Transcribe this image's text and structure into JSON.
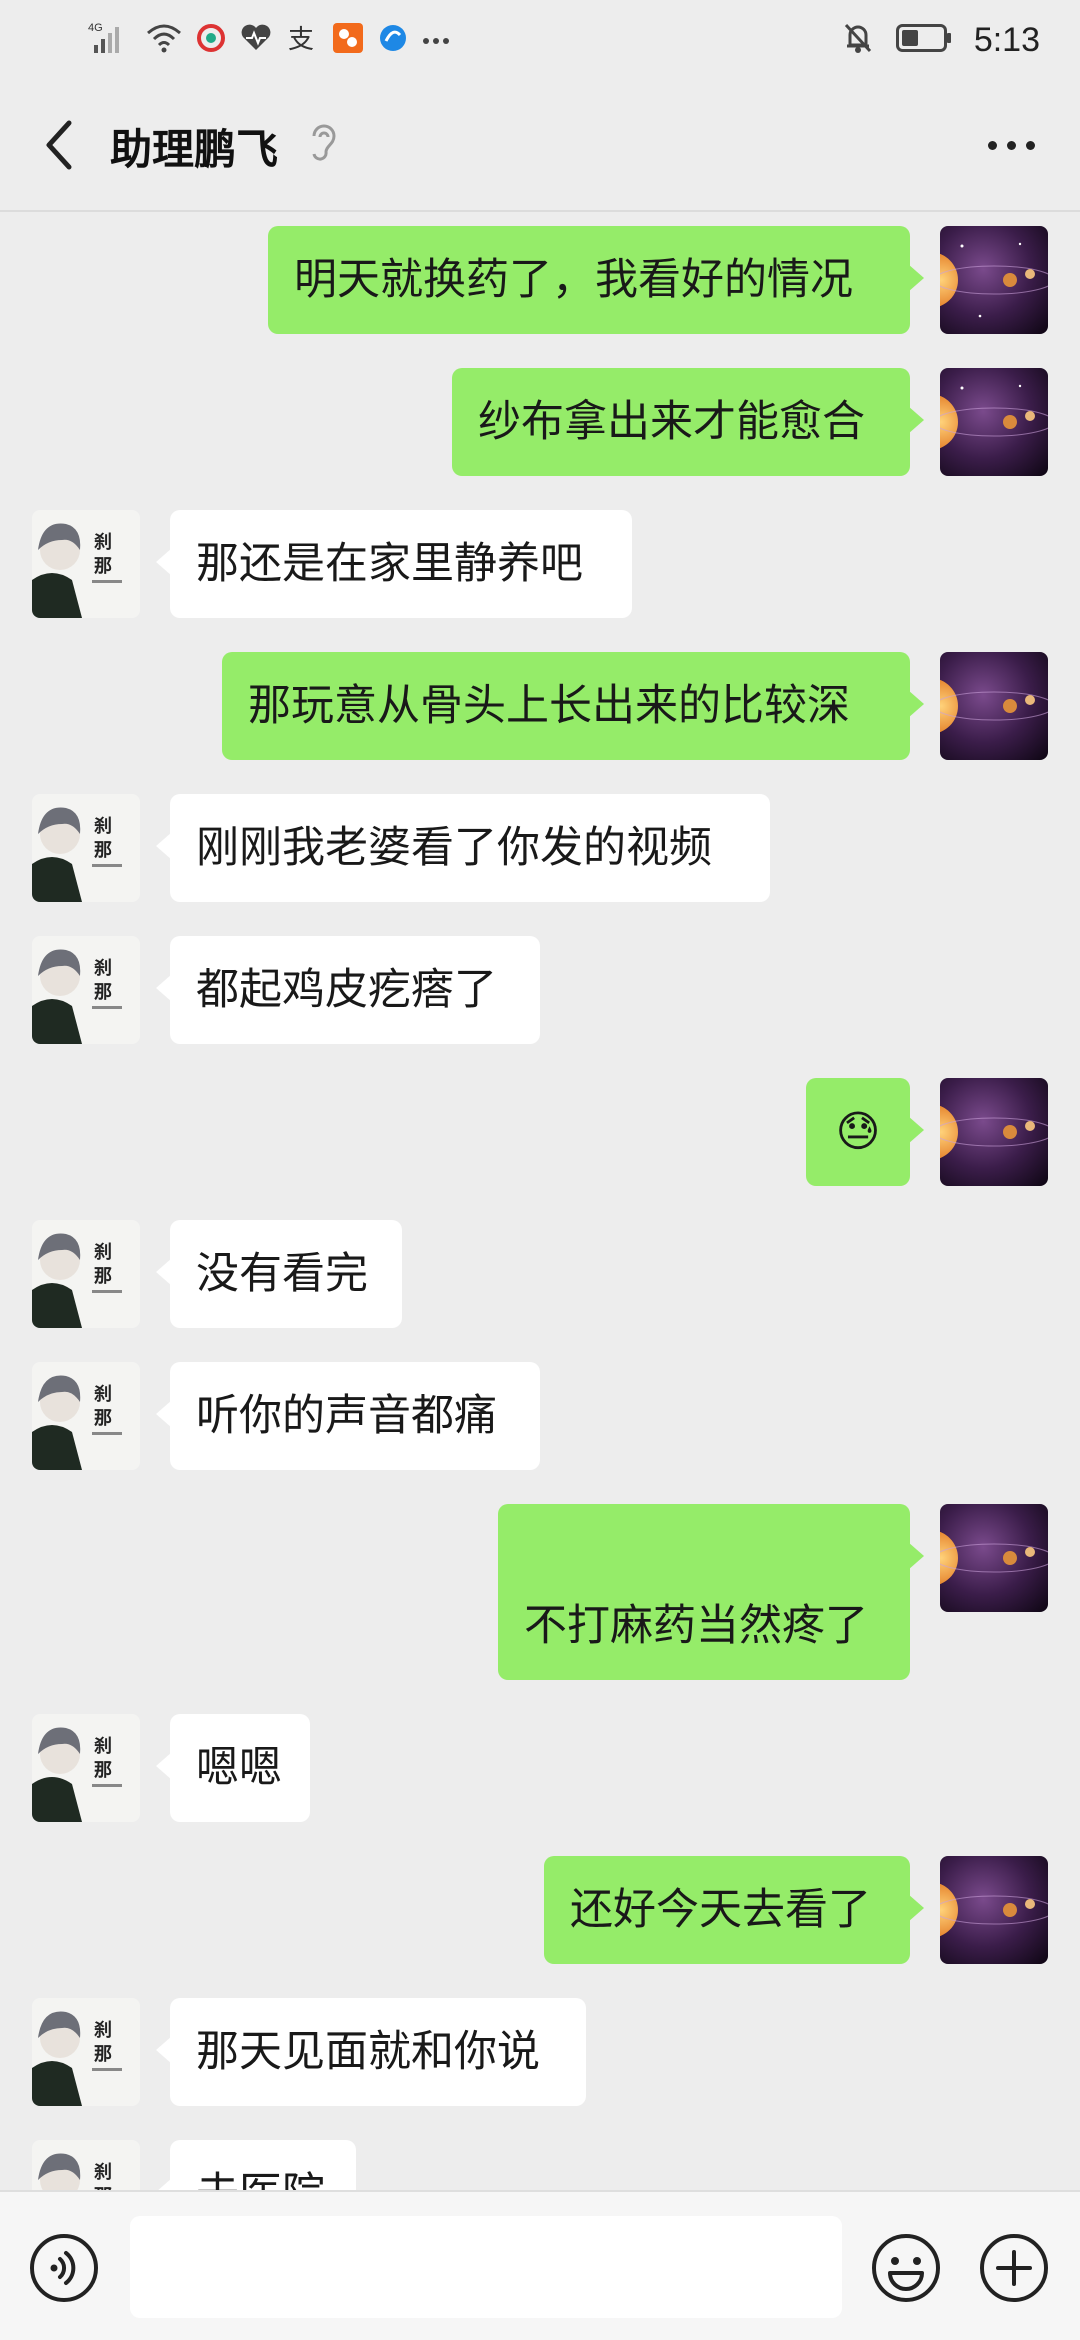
{
  "status_bar": {
    "network": "4G",
    "time": "5:13",
    "icons": [
      "signal-icon",
      "wifi-icon",
      "app-icon",
      "heart-icon",
      "alipay-icon",
      "app-orange-icon",
      "browser-icon",
      "more-dots-icon",
      "mute-bell-icon",
      "battery-icon"
    ]
  },
  "header": {
    "title": "助理鹏飞",
    "back_icon": "chevron-left-icon",
    "ear_icon": "ear-icon",
    "more_icon": "more-dots-icon"
  },
  "colors": {
    "my_bubble": "#95ec69",
    "their_bubble": "#ffffff",
    "background": "#ededed"
  },
  "messages": [
    {
      "from": "me",
      "text": "明天就换药了，我看好的情况"
    },
    {
      "from": "me",
      "text": "纱布拿出来才能愈合"
    },
    {
      "from": "them",
      "text": "那还是在家里静养吧"
    },
    {
      "from": "me",
      "text": "那玩意从骨头上长出来的比较深"
    },
    {
      "from": "them",
      "text": "刚刚我老婆看了你发的视频"
    },
    {
      "from": "them",
      "text": "都起鸡皮疙瘩了"
    },
    {
      "from": "me",
      "text": "😓"
    },
    {
      "from": "them",
      "text": "没有看完"
    },
    {
      "from": "them",
      "text": "听你的声音都痛"
    },
    {
      "from": "me",
      "text": "不打麻药当然疼了"
    },
    {
      "from": "them",
      "text": "嗯嗯"
    },
    {
      "from": "me",
      "text": "还好今天去看了"
    },
    {
      "from": "them",
      "text": "那天见面就和你说"
    },
    {
      "from": "them",
      "text": "去医院"
    }
  ],
  "input_bar": {
    "value": "",
    "voice_icon": "voice-icon",
    "emoji_icon": "emoji-icon",
    "plus_icon": "plus-icon"
  }
}
